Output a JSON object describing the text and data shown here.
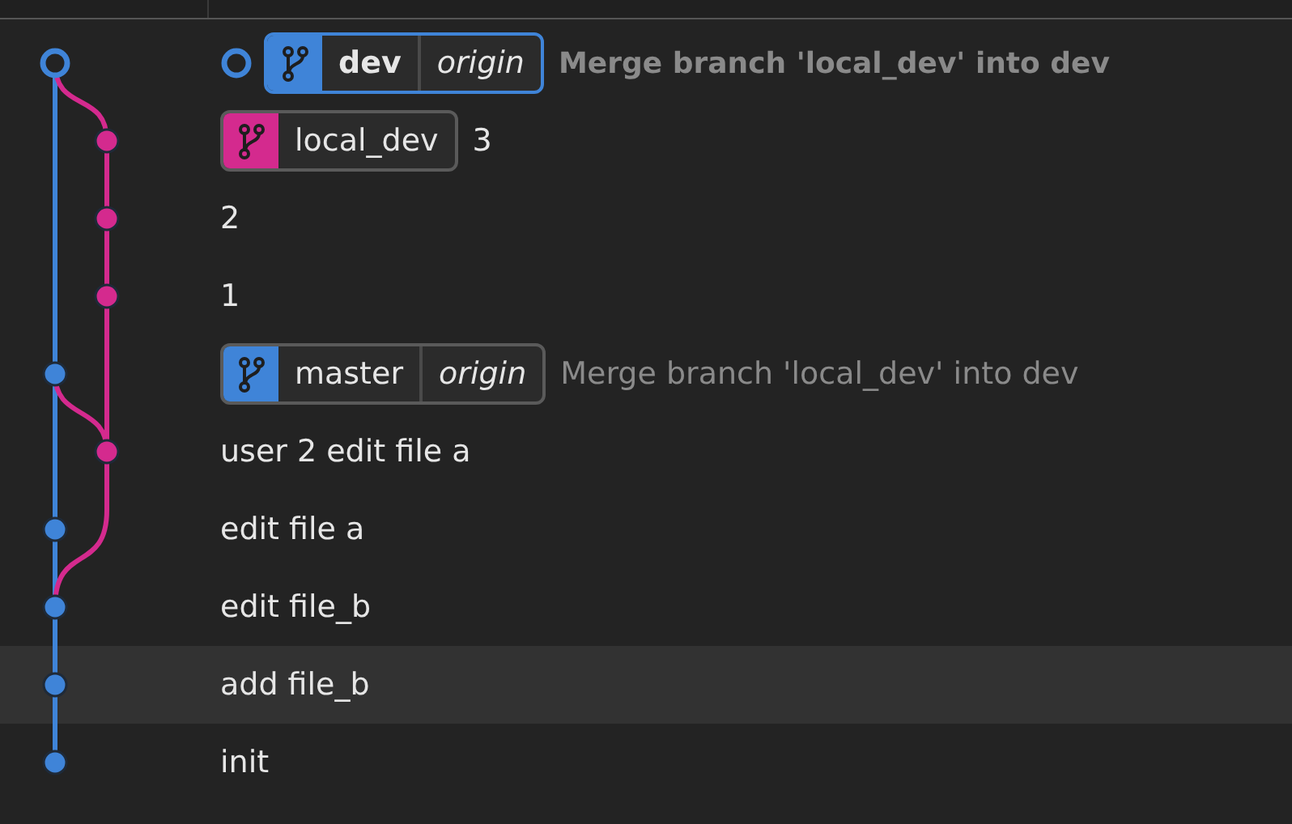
{
  "commits": [
    {
      "message": "Merge branch 'local_dev' into dev",
      "current": true,
      "dimmed": true,
      "selected": false,
      "node": {
        "kind": "main",
        "color": "#3f84d8"
      },
      "refs": [
        {
          "name": "dev",
          "remote": "origin",
          "color": "#3f84d8"
        }
      ]
    },
    {
      "message": "3",
      "current": false,
      "dimmed": false,
      "selected": false,
      "node": {
        "kind": "side",
        "color": "#d42a8e"
      },
      "refs": [
        {
          "name": "local_dev",
          "color": "#d42a8e"
        }
      ]
    },
    {
      "message": "2",
      "current": false,
      "dimmed": false,
      "selected": false,
      "node": {
        "kind": "side",
        "color": "#d42a8e"
      }
    },
    {
      "message": "1",
      "current": false,
      "dimmed": false,
      "selected": false,
      "node": {
        "kind": "side",
        "color": "#d42a8e"
      }
    },
    {
      "message": "Merge branch 'local_dev' into dev",
      "current": false,
      "dimmed": true,
      "selected": false,
      "node": {
        "kind": "main",
        "color": "#3f84d8"
      },
      "refs": [
        {
          "name": "master",
          "remote": "origin",
          "color": "#3f84d8"
        }
      ]
    },
    {
      "message": "user 2 edit file a",
      "current": false,
      "dimmed": false,
      "selected": false,
      "node": {
        "kind": "side",
        "color": "#d42a8e"
      }
    },
    {
      "message": "edit file a",
      "current": false,
      "dimmed": false,
      "selected": false,
      "node": {
        "kind": "main",
        "color": "#3f84d8"
      }
    },
    {
      "message": "edit file_b",
      "current": false,
      "dimmed": false,
      "selected": false,
      "node": {
        "kind": "main",
        "color": "#3f84d8"
      }
    },
    {
      "message": "add file_b",
      "current": false,
      "dimmed": false,
      "selected": true,
      "node": {
        "kind": "main",
        "color": "#3f84d8"
      }
    },
    {
      "message": "init",
      "current": false,
      "dimmed": false,
      "selected": false,
      "node": {
        "kind": "main",
        "color": "#3f84d8"
      }
    }
  ]
}
